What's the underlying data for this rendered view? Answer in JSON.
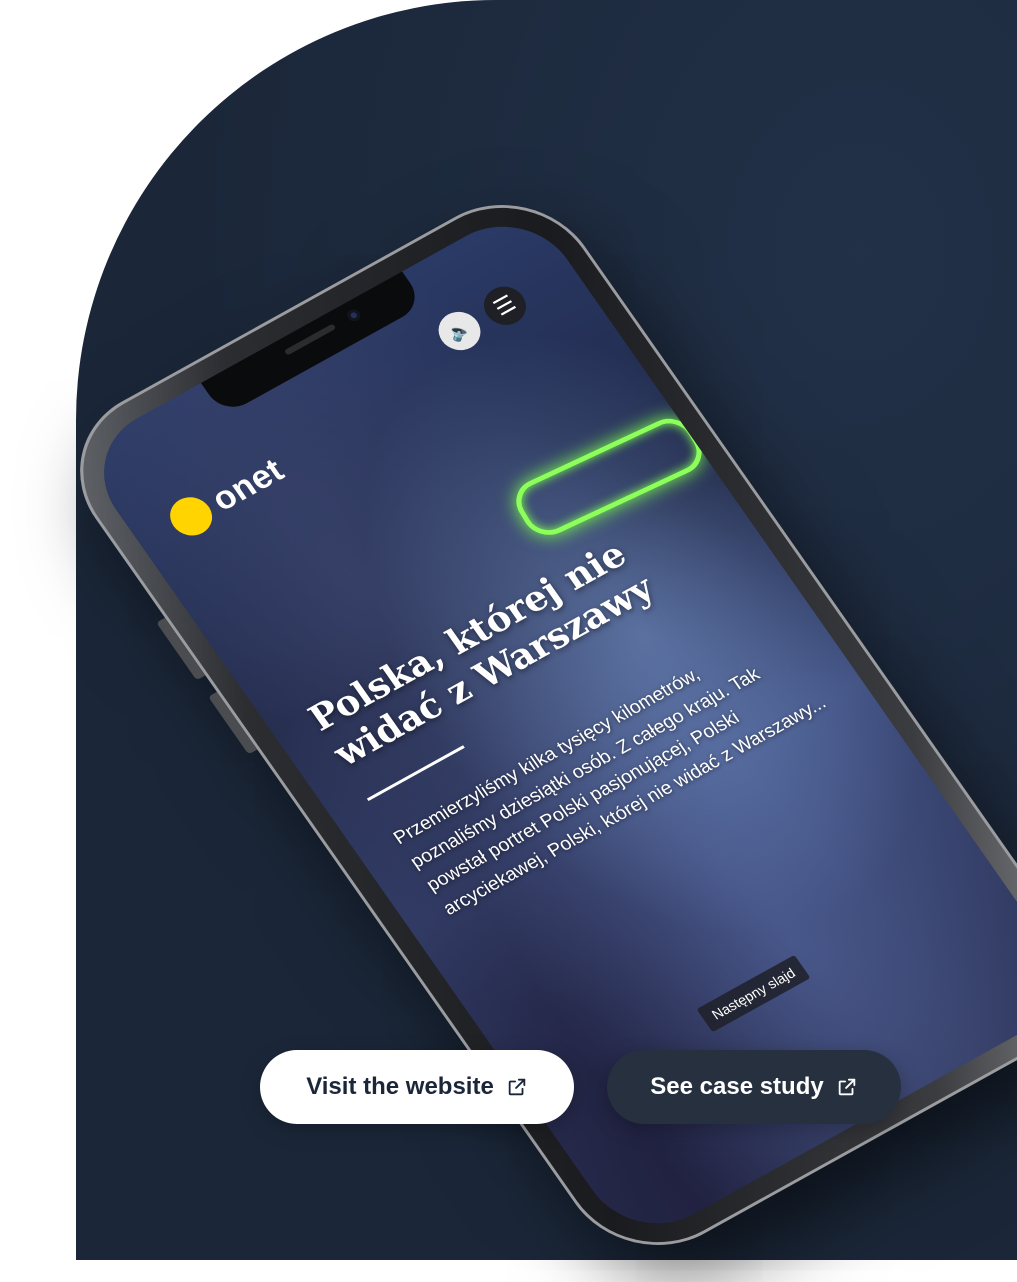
{
  "site": {
    "logo_text": "onet",
    "headline": "Polska, której nie widać z Warszawy",
    "lead": "Przemierzyliśmy kilka tysięcy kilometrów, poznaliśmy dziesiątki osób. Z całego kraju. Tak powstał portret Polski pasjonującej, Polski arcyciekawej, Polski, której nie widać z Warszawy...",
    "next_slide_label": "Następny slajd",
    "sound_icon": "speaker-icon",
    "menu_icon": "hamburger-icon"
  },
  "cta": {
    "visit_label": "Visit the website",
    "case_label": "See case study",
    "icon": "external-link-icon"
  },
  "colors": {
    "background_shape": "#1b2739",
    "logo_yellow": "#ffd400",
    "cta_dark": "#26303f",
    "cta_light": "#ffffff",
    "glasses_neon": "#8dff5a"
  }
}
